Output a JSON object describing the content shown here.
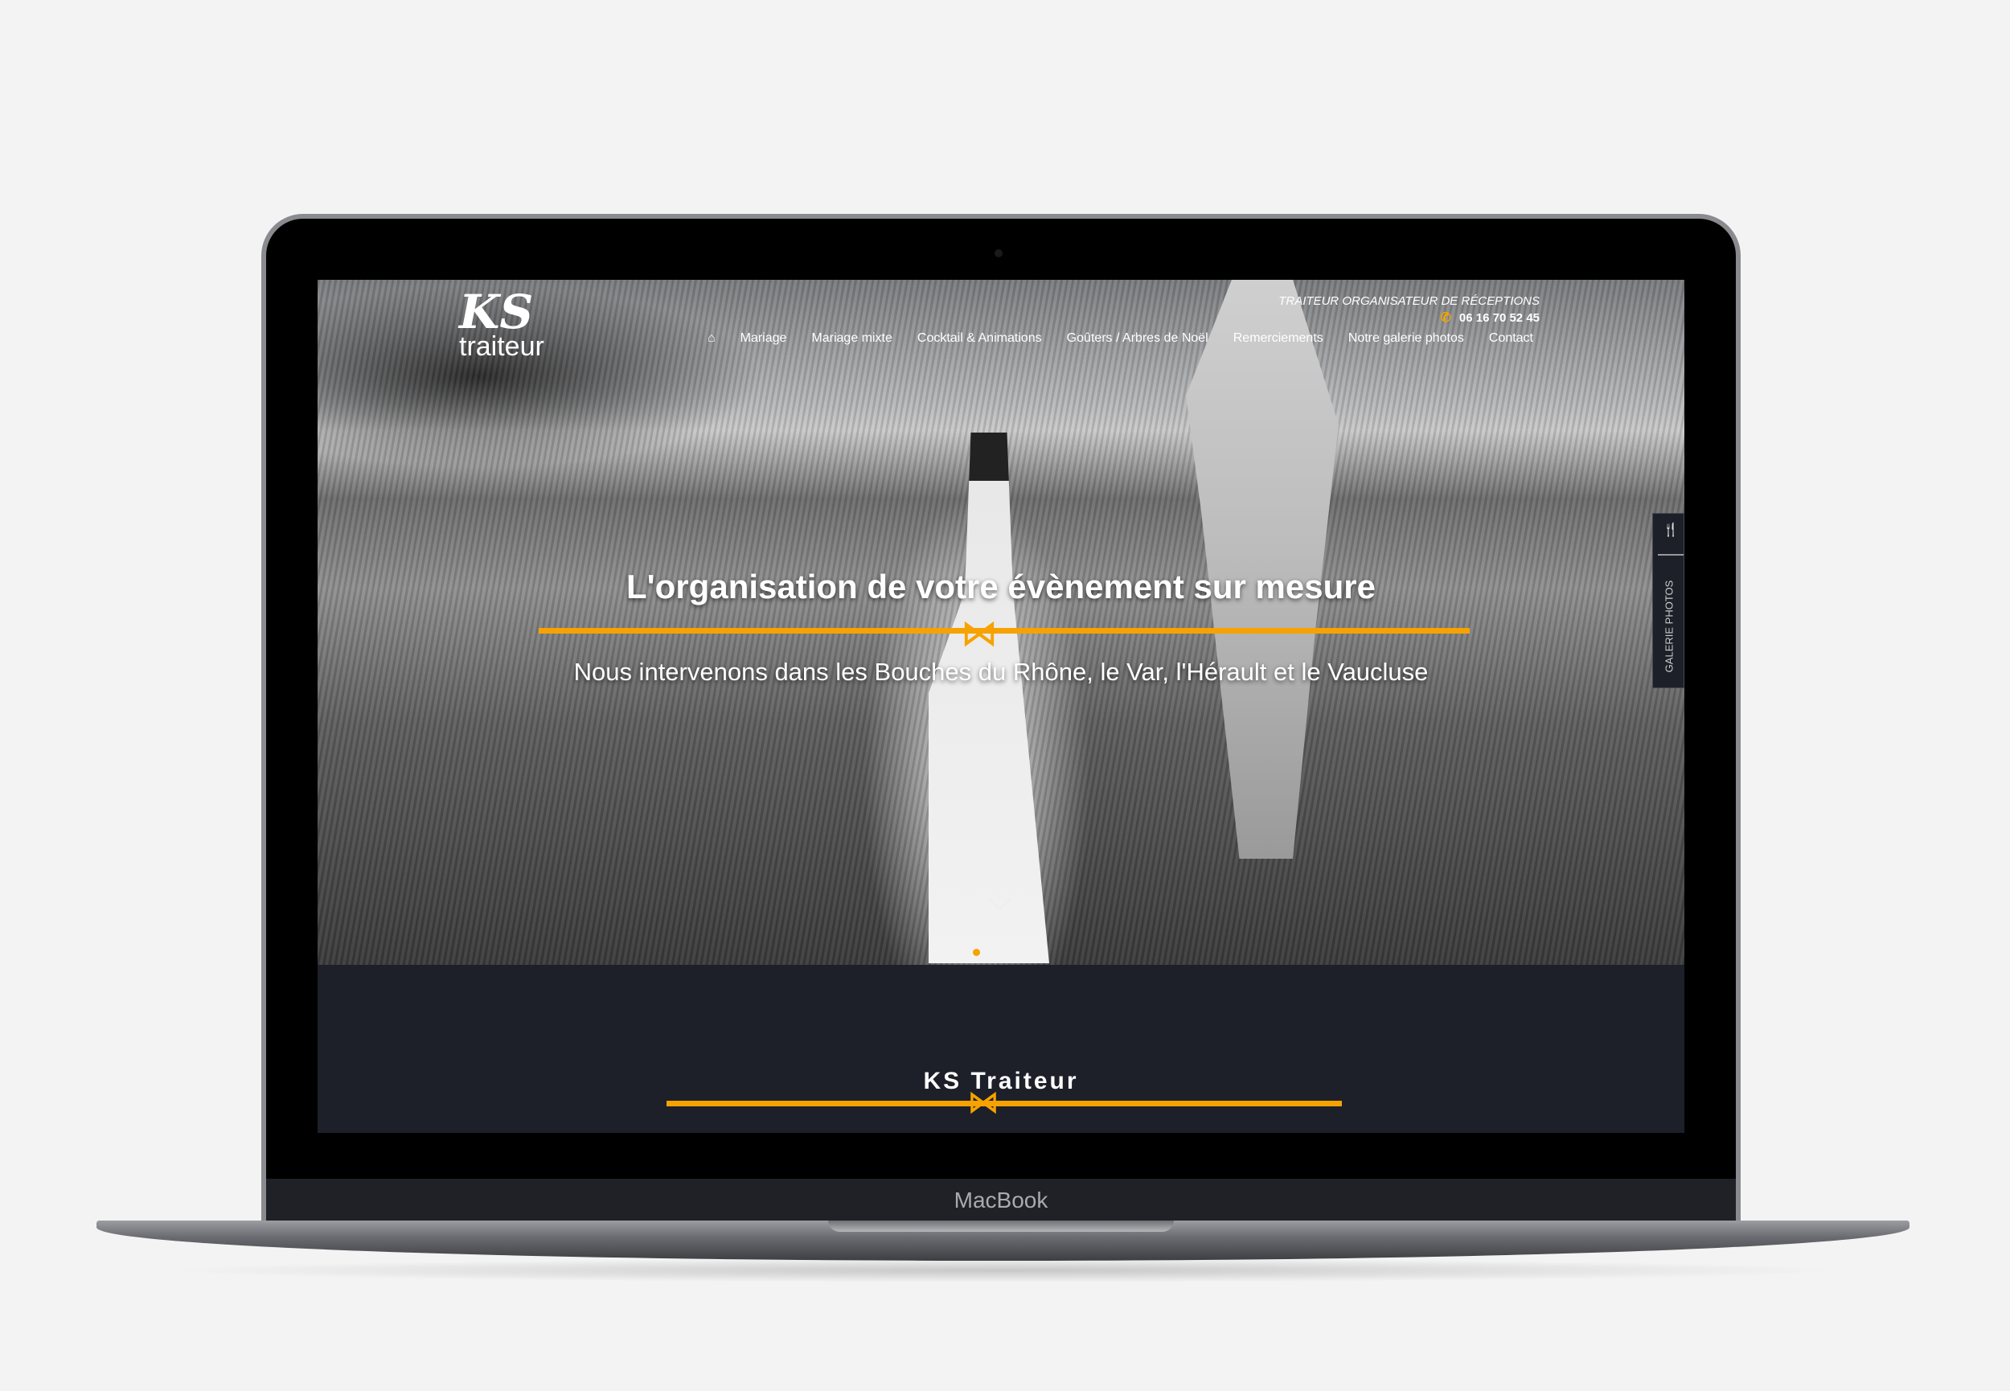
{
  "device": {
    "label": "MacBook"
  },
  "site": {
    "logo_text": "KS traiteur",
    "tagline": "TRAITEUR ORGANISATEUR DE RÉCEPTIONS",
    "phone": "06 16 70 52 45",
    "nav": [
      {
        "label": "Mariage"
      },
      {
        "label": "Mariage mixte"
      },
      {
        "label": "Cocktail & Animations"
      },
      {
        "label": "Goûters / Arbres de Noël"
      },
      {
        "label": "Remerciements"
      },
      {
        "label": "Notre galerie photos"
      },
      {
        "label": "Contact"
      }
    ],
    "hero": {
      "title": "L'organisation de votre évènement sur mesure",
      "subtitle": "Nous intervenons dans les Bouches du Rhône, le Var, l'Hérault et le Vaucluse"
    },
    "side_tab": {
      "label": "GALERIE PHOTOS",
      "icon": "cutlery-icon"
    },
    "section_title": "KS Traiteur",
    "colors": {
      "accent": "#f6a200",
      "dark": "#1d2029"
    }
  }
}
